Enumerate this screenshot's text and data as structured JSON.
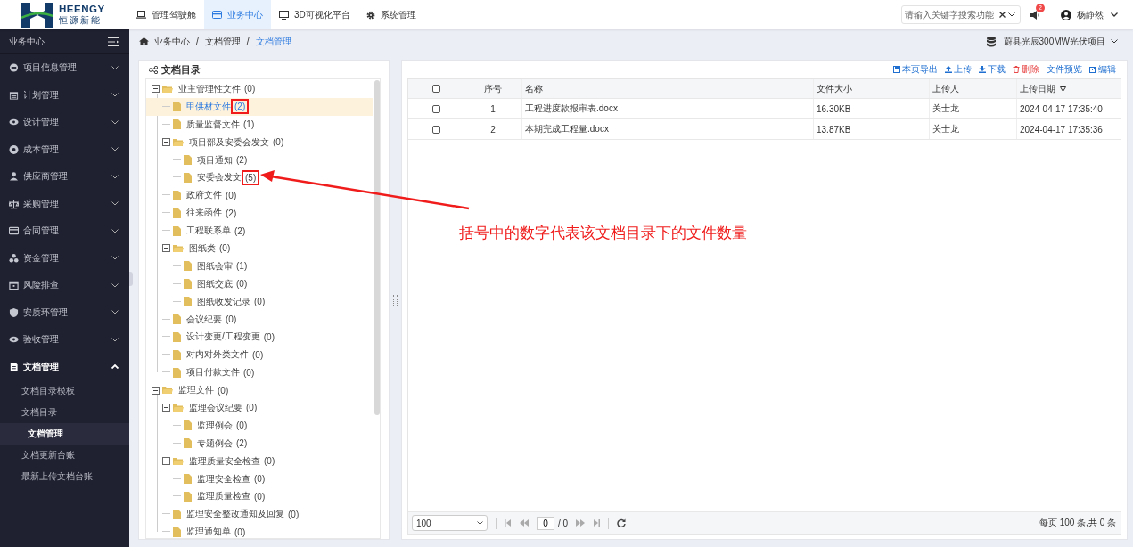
{
  "header": {
    "logo": {
      "name": "HEENGY",
      "subtitle": "恒源新能"
    },
    "nav": [
      {
        "label": "管理驾驶舱",
        "selected": false
      },
      {
        "label": "业务中心",
        "selected": true
      },
      {
        "label": "3D可视化平台",
        "selected": false
      },
      {
        "label": "系统管理",
        "selected": false
      }
    ],
    "search": {
      "placeholder": "请输入关键字搜索功能"
    },
    "notifications": {
      "badge": "2"
    },
    "user": {
      "name": "杨静然"
    }
  },
  "sidebar": {
    "title": "业务中心",
    "items": [
      {
        "label": "项目信息管理",
        "expanded": false
      },
      {
        "label": "计划管理",
        "expanded": false
      },
      {
        "label": "设计管理",
        "expanded": false
      },
      {
        "label": "成本管理",
        "expanded": false
      },
      {
        "label": "供应商管理",
        "expanded": false
      },
      {
        "label": "采购管理",
        "expanded": false
      },
      {
        "label": "合同管理",
        "expanded": false
      },
      {
        "label": "资金管理",
        "expanded": false
      },
      {
        "label": "风险排查",
        "expanded": false
      },
      {
        "label": "安质环管理",
        "expanded": false
      },
      {
        "label": "验收管理",
        "expanded": false
      },
      {
        "label": "文档管理",
        "expanded": true,
        "children": [
          {
            "label": "文档目录模板",
            "selected": false
          },
          {
            "label": "文档目录",
            "selected": false
          },
          {
            "label": "文档管理",
            "selected": true
          },
          {
            "label": "文档更新台账",
            "selected": false
          },
          {
            "label": "最新上传文档台账",
            "selected": false
          }
        ]
      }
    ]
  },
  "breadcrumb": [
    {
      "kind": "link",
      "label": "业务中心"
    },
    {
      "kind": "separator",
      "label": "/"
    },
    {
      "kind": "link",
      "label": "文档管理"
    },
    {
      "kind": "separator",
      "label": "/"
    },
    {
      "kind": "current",
      "label": "文档管理"
    }
  ],
  "project": {
    "name": "蔚县光辰300MW光伏项目"
  },
  "catalog": {
    "title": "文档目录",
    "tree": [
      {
        "kind": "folder",
        "label": "业主管理性文件",
        "count": "(0)",
        "highlighted": false,
        "expanded": true,
        "selected": false,
        "children": [
          {
            "kind": "file",
            "label": "甲供材文件",
            "count": "(2)",
            "highlighted": true,
            "selected": true
          },
          {
            "kind": "file",
            "label": "质量监督文件",
            "count": "(1)",
            "highlighted": false,
            "selected": false
          },
          {
            "kind": "folder",
            "label": "项目部及安委会发文",
            "count": "(0)",
            "highlighted": false,
            "expanded": true,
            "selected": false,
            "children": [
              {
                "kind": "file",
                "label": "项目通知",
                "count": "(2)",
                "highlighted": false,
                "selected": false
              },
              {
                "kind": "file",
                "label": "安委会发文",
                "count": "(5)",
                "highlighted": true,
                "selected": false
              }
            ]
          },
          {
            "kind": "file",
            "label": "政府文件",
            "count": "(0)",
            "highlighted": false,
            "selected": false
          },
          {
            "kind": "file",
            "label": "往来函件",
            "count": "(2)",
            "highlighted": false,
            "selected": false
          },
          {
            "kind": "file",
            "label": "工程联系单",
            "count": "(2)",
            "highlighted": false,
            "selected": false
          },
          {
            "kind": "folder",
            "label": "图纸类",
            "count": "(0)",
            "highlighted": false,
            "expanded": true,
            "selected": false,
            "children": [
              {
                "kind": "file",
                "label": "图纸会审",
                "count": "(1)",
                "highlighted": false,
                "selected": false
              },
              {
                "kind": "file",
                "label": "图纸交底",
                "count": "(0)",
                "highlighted": false,
                "selected": false
              },
              {
                "kind": "file",
                "label": "图纸收发记录",
                "count": "(0)",
                "highlighted": false,
                "selected": false
              }
            ]
          },
          {
            "kind": "file",
            "label": "会议纪要",
            "count": "(0)",
            "highlighted": false,
            "selected": false
          },
          {
            "kind": "file",
            "label": "设计变更/工程变更",
            "count": "(0)",
            "highlighted": false,
            "selected": false
          },
          {
            "kind": "file",
            "label": "对内对外类文件",
            "count": "(0)",
            "highlighted": false,
            "selected": false
          },
          {
            "kind": "file",
            "label": "项目付款文件",
            "count": "(0)",
            "highlighted": false,
            "selected": false
          }
        ]
      },
      {
        "kind": "folder",
        "label": "监理文件",
        "count": "(0)",
        "highlighted": false,
        "expanded": true,
        "selected": false,
        "children": [
          {
            "kind": "folder",
            "label": "监理会议纪要",
            "count": "(0)",
            "highlighted": false,
            "expanded": true,
            "selected": false,
            "children": [
              {
                "kind": "file",
                "label": "监理例会",
                "count": "(0)",
                "highlighted": false,
                "selected": false
              },
              {
                "kind": "file",
                "label": "专题例会",
                "count": "(2)",
                "highlighted": false,
                "selected": false
              }
            ]
          },
          {
            "kind": "folder",
            "label": "监理质量安全检查",
            "count": "(0)",
            "highlighted": false,
            "expanded": true,
            "selected": false,
            "children": [
              {
                "kind": "file",
                "label": "监理安全检查",
                "count": "(0)",
                "highlighted": false,
                "selected": false
              },
              {
                "kind": "file",
                "label": "监理质量检查",
                "count": "(0)",
                "highlighted": false,
                "selected": false
              }
            ]
          },
          {
            "kind": "file",
            "label": "监理安全整改通知及回复",
            "count": "(0)",
            "highlighted": false,
            "selected": false
          },
          {
            "kind": "file",
            "label": "监理通知单",
            "count": "(0)",
            "highlighted": false,
            "selected": false
          }
        ]
      }
    ]
  },
  "toolbar": [
    {
      "label": "本页导出",
      "kind": "export"
    },
    {
      "label": "上传",
      "kind": "upload"
    },
    {
      "label": "下载",
      "kind": "download"
    },
    {
      "label": "删除",
      "kind": "delete"
    },
    {
      "label": "文件预览",
      "kind": "preview"
    },
    {
      "label": "编辑",
      "kind": "edit"
    }
  ],
  "table": {
    "columns": [
      "序号",
      "名称",
      "文件大小",
      "上传人",
      "上传日期"
    ],
    "header_checked": false,
    "rows": [
      {
        "checked": false,
        "cells": [
          "1",
          "工程进度款报审表.docx",
          "16.30KB",
          "关士龙",
          "2024-04-17 17:35:40"
        ]
      },
      {
        "checked": false,
        "cells": [
          "2",
          "本期完成工程量.docx",
          "13.87KB",
          "关士龙",
          "2024-04-17 17:35:36"
        ]
      }
    ]
  },
  "pager": {
    "page_size": "100",
    "page": "0",
    "total_pages": "/ 0",
    "summary": "每页 100 条,共 0 条"
  },
  "annotation": {
    "text": "括号中的数字代表该文档目录下的文件数量"
  }
}
